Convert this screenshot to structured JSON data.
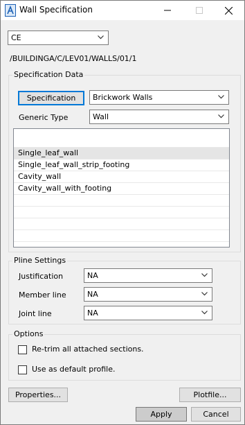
{
  "window": {
    "title": "Wall Specification",
    "controls": {
      "minimize": "minimize",
      "maximize": "maximize",
      "close": "close"
    }
  },
  "top": {
    "mode_select": "CE",
    "path": "/BUILDINGA/C/LEV01/WALLS/01/1"
  },
  "spec_data": {
    "caption": "Specification Data",
    "specification_button": "Specification",
    "specification_value": "Brickwork Walls",
    "generic_type_label": "Generic Type",
    "generic_type_value": "Wall",
    "items": [
      "",
      "Single_leaf_wall",
      "Single_leaf_wall_strip_footing",
      "Cavity_wall",
      "Cavity_wall_with_footing",
      "",
      "",
      "",
      "",
      ""
    ],
    "selected_index": 1
  },
  "pline": {
    "caption": "Pline Settings",
    "justification_label": "Justification",
    "justification_value": "NA",
    "member_line_label": "Member line",
    "member_line_value": "NA",
    "joint_line_label": "Joint line",
    "joint_line_value": "NA"
  },
  "options": {
    "caption": "Options",
    "retrim_label": "Re-trim all attached sections.",
    "retrim_checked": false,
    "default_profile_label": "Use as default profile.",
    "default_profile_checked": false
  },
  "buttons": {
    "properties": "Properties...",
    "plotfile": "Plotfile...",
    "apply": "Apply",
    "cancel": "Cancel"
  }
}
